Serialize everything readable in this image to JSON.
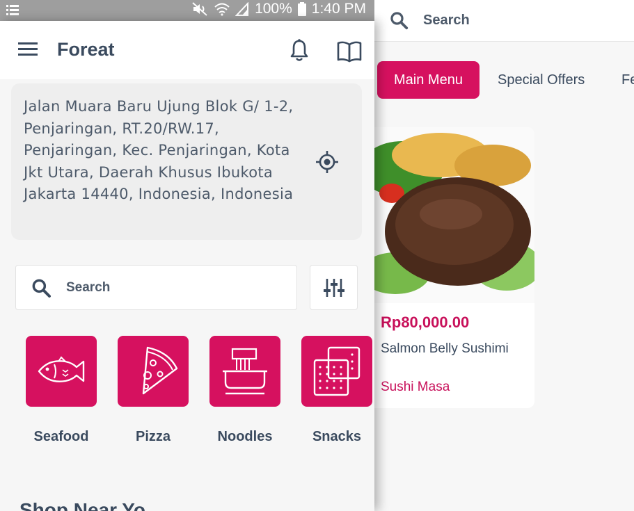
{
  "status_bar": {
    "battery": "100%",
    "time": "1:40 PM"
  },
  "background": {
    "search_placeholder": "Search",
    "tabs": [
      {
        "label": "Main Menu",
        "active": true
      },
      {
        "label": "Special Offers",
        "active": false
      },
      {
        "label": "Fe",
        "active": false
      }
    ],
    "card": {
      "price": "Rp80,000.00",
      "name": "Salmon Belly Sushimi",
      "shop": "Sushi Masa"
    }
  },
  "drawer": {
    "brand": "Foreat",
    "address": "Jalan Muara Baru Ujung Blok G/ 1-2, Penjaringan, RT.20/RW.17, Penjaringan, Kec. Penjaringan, Kota Jkt Utara, Daerah Khusus Ibukota Jakarta 14440, Indonesia, Indonesia",
    "search_placeholder": "Search",
    "categories": [
      {
        "label": "Seafood",
        "icon": "fish-icon"
      },
      {
        "label": "Pizza",
        "icon": "pizza-icon"
      },
      {
        "label": "Noodles",
        "icon": "noodles-icon"
      },
      {
        "label": "Snacks",
        "icon": "snacks-icon"
      }
    ],
    "section_heading": "Shop Near Yo"
  },
  "colors": {
    "accent": "#d6115f",
    "text": "#3a4a5e"
  }
}
